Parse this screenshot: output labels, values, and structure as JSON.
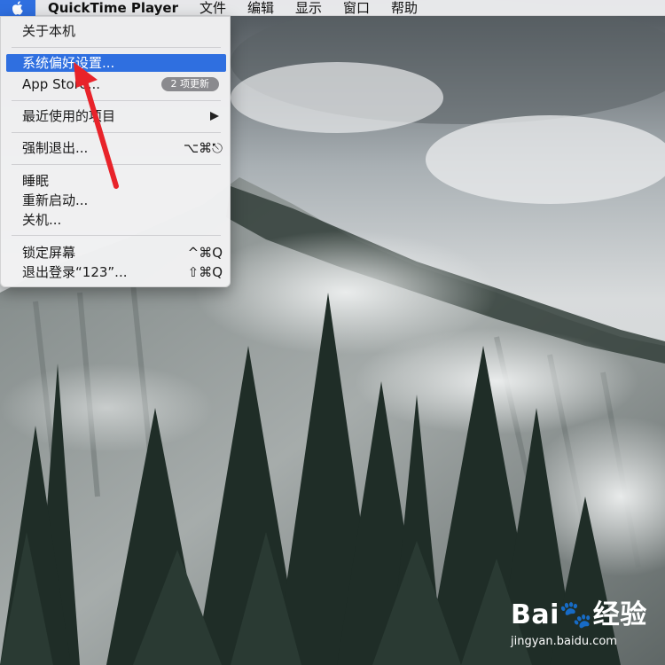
{
  "menubar": {
    "apple_icon": "apple-icon",
    "app_name": "QuickTime Player",
    "items": [
      "文件",
      "编辑",
      "显示",
      "窗口",
      "帮助"
    ]
  },
  "apple_menu": {
    "items": [
      {
        "label": "关于本机"
      },
      {
        "label": "系统偏好设置...",
        "highlighted": true
      },
      {
        "label": "App Store...",
        "badge": "2 项更新"
      },
      {
        "label": "最近使用的项目",
        "submenu": true
      },
      {
        "label": "强制退出...",
        "shortcut": "⌥⌘⎋"
      },
      {
        "label": "睡眠"
      },
      {
        "label": "重新启动..."
      },
      {
        "label": "关机..."
      },
      {
        "label": "锁定屏幕",
        "shortcut": "^⌘Q"
      },
      {
        "label": "退出登录“123”...",
        "shortcut": "⇧⌘Q"
      }
    ]
  },
  "watermark": {
    "logo_text": "Bai🐾经验",
    "url": "jingyan.baidu.com"
  },
  "colors": {
    "highlight": "#2f6fe0",
    "annotation_arrow": "#e8232a"
  }
}
